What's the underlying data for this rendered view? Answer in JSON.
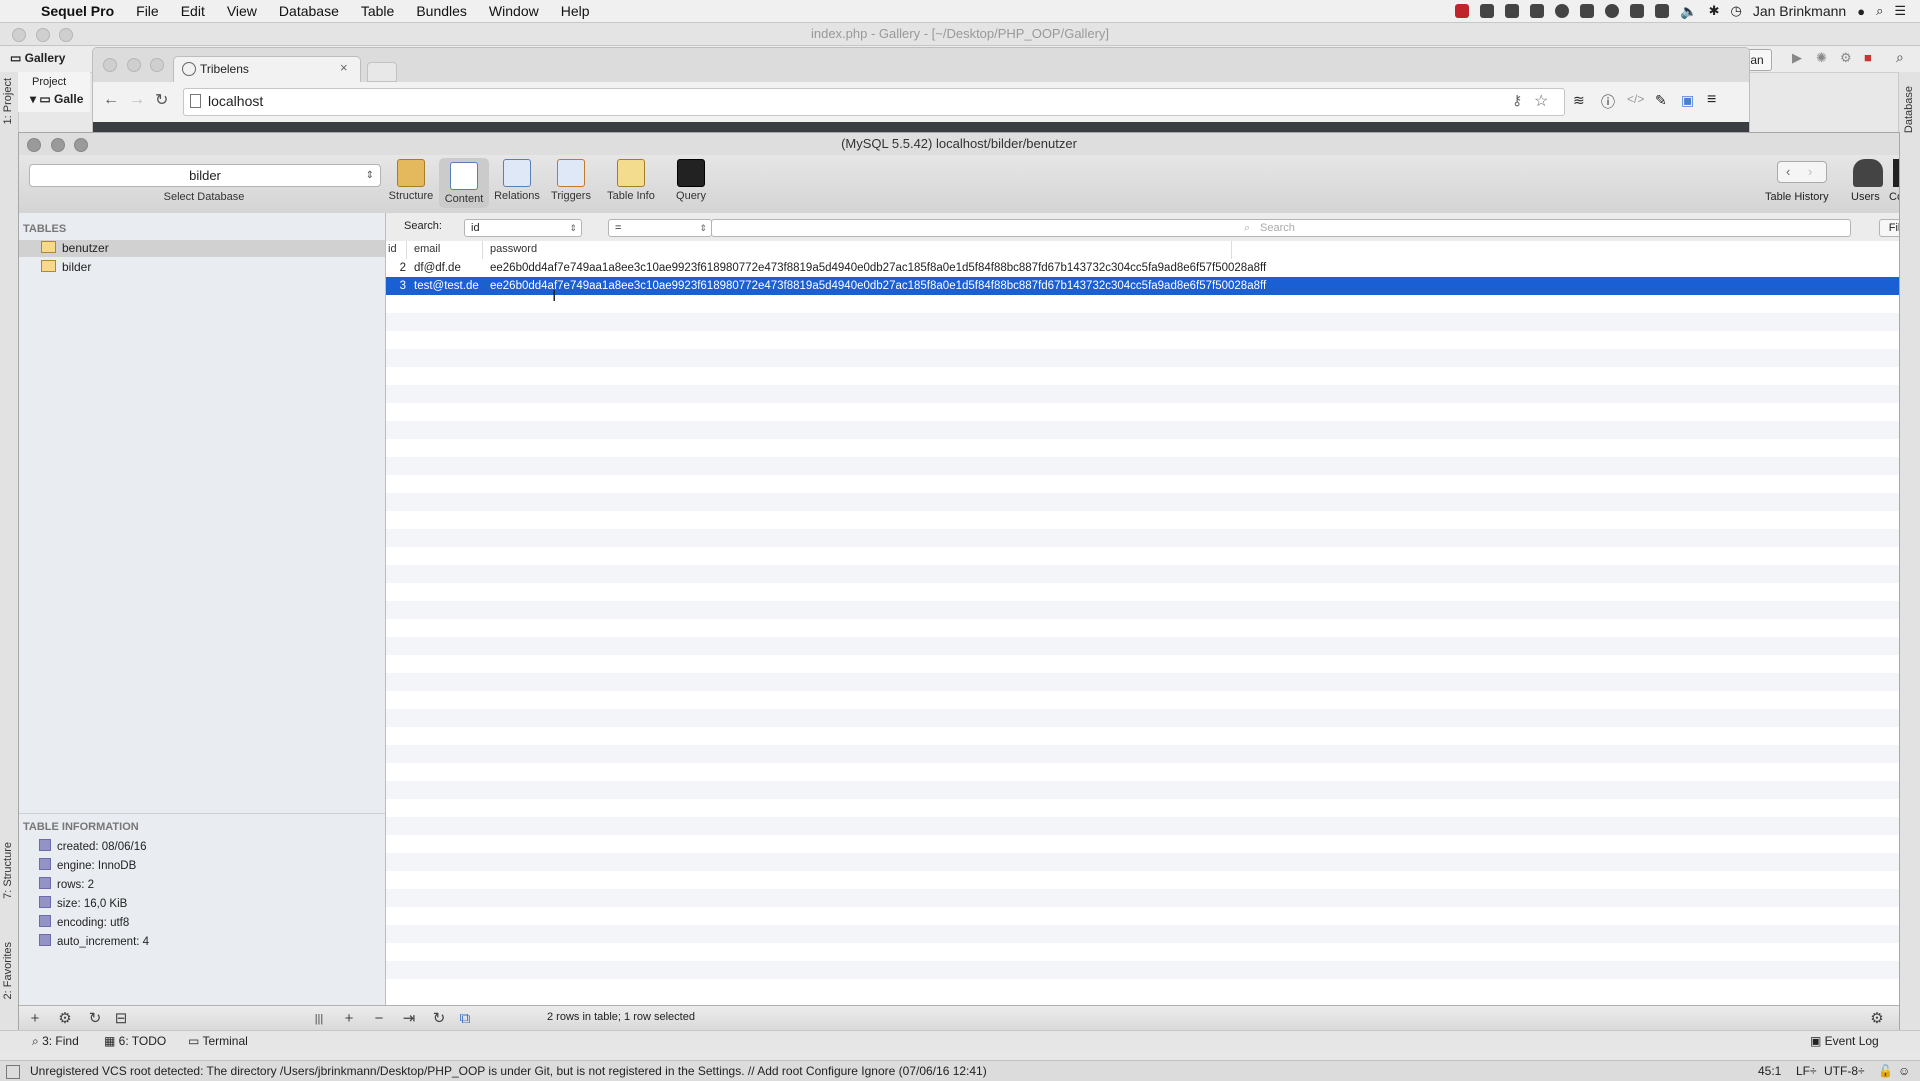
{
  "menubar": {
    "app_name": "Sequel Pro",
    "items": [
      "File",
      "Edit",
      "View",
      "Database",
      "Table",
      "Bundles",
      "Window",
      "Help"
    ],
    "user": "Jan Brinkmann"
  },
  "ide": {
    "window_title": "index.php - Gallery - [~/Desktop/PHP_OOP/Gallery]",
    "nav_folder": "Gallery",
    "project_label": "Project",
    "tree_root": "Galle",
    "left_tabs": [
      "1: Project",
      "7: Structure",
      "2: Favorites"
    ],
    "right_tab": "Database",
    "bottom_tabs": [
      "3: Find",
      "6: TODO",
      "Terminal"
    ],
    "event_log": "Event Log",
    "status_message": "Unregistered VCS root detected: The directory /Users/jbrinkmann/Desktop/PHP_OOP is under Git, but is not registered in the Settings. // Add root  Configure  Ignore (07/06/16 12:41)",
    "cursor_position": "45:1",
    "line_separator": "LF÷",
    "encoding": "UTF-8÷",
    "user_button": "Jan"
  },
  "chrome": {
    "tab_title": "Tribelens",
    "url": "localhost"
  },
  "sequel": {
    "window_title": "(MySQL 5.5.42) localhost/bilder/benutzer",
    "database_select": "bilder",
    "select_database_label": "Select Database",
    "toolbar": [
      {
        "label": "Structure",
        "icon": "structure-icon",
        "active": false
      },
      {
        "label": "Content",
        "icon": "content-icon",
        "active": true
      },
      {
        "label": "Relations",
        "icon": "relations-icon",
        "active": false
      },
      {
        "label": "Triggers",
        "icon": "triggers-icon",
        "active": false
      },
      {
        "label": "Table Info",
        "icon": "table-info-icon",
        "active": false
      },
      {
        "label": "Query",
        "icon": "query-icon",
        "active": false
      }
    ],
    "right_toolbar": {
      "history": "Table History",
      "users": "Users",
      "console": "Conso"
    },
    "tables_heading": "TABLES",
    "tables": [
      {
        "name": "benutzer",
        "selected": true
      },
      {
        "name": "bilder",
        "selected": false
      }
    ],
    "table_info_heading": "TABLE INFORMATION",
    "table_info": [
      "created: 08/06/16",
      "engine: InnoDB",
      "rows: 2",
      "size: 16,0 KiB",
      "encoding: utf8",
      "auto_increment: 4"
    ],
    "filter": {
      "label": "Search:",
      "field": "id",
      "operator": "=",
      "search_placeholder": "Search",
      "button": "Filter"
    },
    "columns": [
      "id",
      "email",
      "password"
    ],
    "rows": [
      {
        "id": "2",
        "email": "df@df.de",
        "password": "ee26b0dd4af7e749aa1a8ee3c10ae9923f618980772e473f8819a5d4940e0db27ac185f8a0e1d5f84f88bc887fd67b143732c304cc5fa9ad8e6f57f50028a8ff",
        "selected": false
      },
      {
        "id": "3",
        "email": "test@test.de",
        "password": "ee26b0dd4af7e749aa1a8ee3c10ae9923f618980772e473f8819a5d4940e0db27ac185f8a0e1d5f84f88bc887fd67b143732c304cc5fa9ad8e6f57f50028a8ff",
        "selected": true
      }
    ],
    "status": "2 rows in table; 1 row selected"
  },
  "colors": {
    "selection": "#1a5fd4",
    "sidebar": "#e9ecf0"
  }
}
